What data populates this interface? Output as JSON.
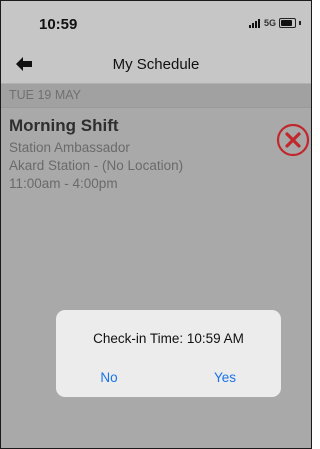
{
  "status_bar": {
    "time": "10:59",
    "network": "5G"
  },
  "nav": {
    "title": "My Schedule"
  },
  "schedule": {
    "day_header": "TUE 19 MAY",
    "shift": {
      "title": "Morning Shift",
      "role": "Station Ambassador",
      "location": "Akard Station - (No Location)",
      "hours": "11:00am - 4:00pm"
    }
  },
  "dialog": {
    "message": "Check-in Time: 10:59 AM",
    "no_label": "No",
    "yes_label": "Yes"
  },
  "colors": {
    "accent_blue": "#1a73e8",
    "cancel_red": "#c0282d"
  }
}
